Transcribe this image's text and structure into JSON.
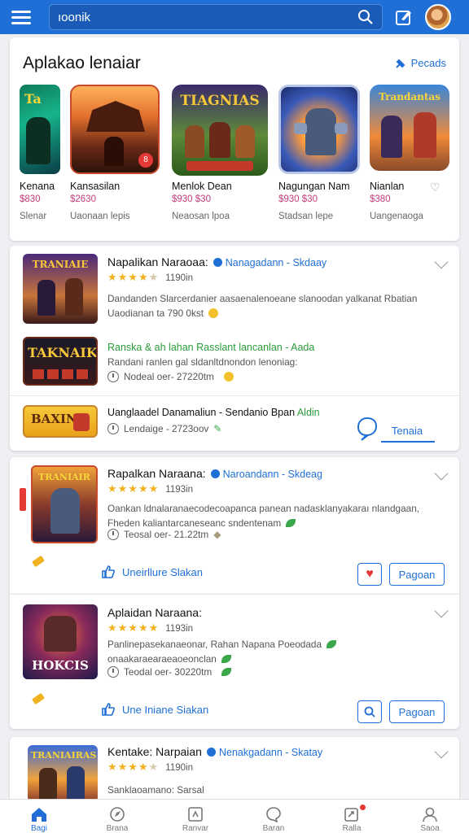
{
  "topbar": {
    "search_value": "ıoonik"
  },
  "featured": {
    "title": "Aplakao lenaiar",
    "link_label": "Pecads",
    "tiles": [
      {
        "name": "Kenana",
        "price": "$830",
        "sub": "Slenar"
      },
      {
        "name": "Kansasilan",
        "price": "$2630",
        "sub": "Uaonaan lepis"
      },
      {
        "name": "Menlok Dean",
        "price": "$930 $30",
        "sub": "Neaosan lpoa"
      },
      {
        "name": "Nagungan Nam",
        "price": "$930 $30",
        "sub": "Stadsan lepe"
      },
      {
        "name": "Nianlan",
        "price": "$380",
        "sub": "Uangenaoga"
      }
    ]
  },
  "list_card_1": {
    "title": "Napalikan Naraoaa:",
    "developer": "Nanagadann - Skdaay",
    "rating_count": "1190in",
    "desc_line1": "Dandanden Slarcerdanier aasaenalenoeane slanoodan yalkanat Rbatian",
    "desc_line2": "Uaodianan ta 790 0kst",
    "sub_title": "Ranska & ah lahan Rasslant lancanlan - Aada",
    "sub_desc": "Randani ranlen gal sldanltdnondon lenoniag:",
    "sub_meta": "Nodeal oer- 27220tm",
    "footer_title": "Uanglaadel Danamaliun - Sendanio Bpan",
    "footer_green": "Aldin",
    "footer_meta": "Lendaige - 2723oov",
    "footer_button": "Tenaia"
  },
  "list_card_2": {
    "title": "Rapalkan Naraana:",
    "developer": "Naroandann - Skdeag",
    "rating_count": "1193in",
    "desc_line1": "Oankan ldnalaranaecodecoapanca panean nadasklanyakaraı nlandgaan,",
    "desc_line2": "Fheden kaliantarcaneseanc sndentenam",
    "meta": "Teosal oer- 21.22tm",
    "action_label": "Uneirllure Slakan",
    "button_label": "Pagoan"
  },
  "list_card_3": {
    "title": "Aplaidan Naraana:",
    "rating_count": "1193in",
    "desc_line1": "Panlinepasekanaeonar, Rahan Napana Poeodada",
    "desc_line2": "onaakaraearaeaoeonclan",
    "meta": "Teodal oer- 30220tm",
    "action_label": "Une Iniane Siakan",
    "button_label": "Pagoan"
  },
  "list_card_4": {
    "title": "Kentake: Narpaian",
    "developer": "Nenakgadann - Skatay",
    "rating_count": "1190in",
    "desc_line1": "Sanklaoamano: Sarsal"
  },
  "bottomnav": {
    "items": [
      {
        "label": "Bagi",
        "icon": "home-icon"
      },
      {
        "label": "Brana",
        "icon": "compass-icon"
      },
      {
        "label": "Ranvar",
        "icon": "chart-icon"
      },
      {
        "label": "Baran",
        "icon": "chat-icon"
      },
      {
        "label": "Ralla",
        "icon": "notifications-icon"
      },
      {
        "label": "Saoa",
        "icon": "profile-icon"
      }
    ]
  },
  "colors": {
    "brand": "#1f6fd6",
    "green": "#2a9d3a",
    "star": "#f2b11c",
    "price": "#c43a7a"
  }
}
